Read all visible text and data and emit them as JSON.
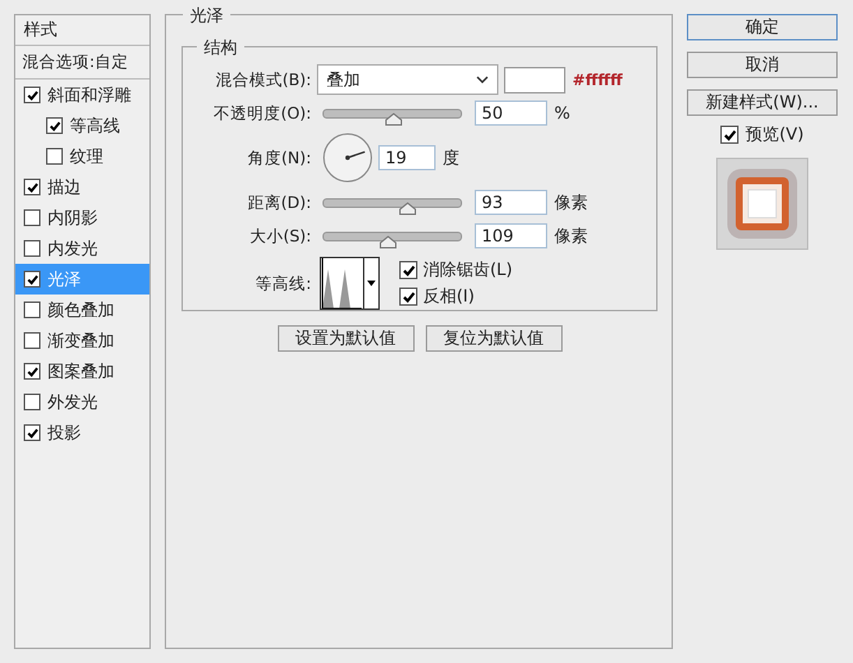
{
  "sidebar": {
    "title": "样式",
    "blend_options": "混合选项:自定",
    "items": [
      {
        "label": "斜面和浮雕",
        "checked": true,
        "selected": false,
        "children": [
          {
            "label": "等高线",
            "checked": true,
            "selected": false
          },
          {
            "label": "纹理",
            "checked": false,
            "selected": false
          }
        ]
      },
      {
        "label": "描边",
        "checked": true,
        "selected": false
      },
      {
        "label": "内阴影",
        "checked": false,
        "selected": false
      },
      {
        "label": "内发光",
        "checked": false,
        "selected": false
      },
      {
        "label": "光泽",
        "checked": true,
        "selected": true
      },
      {
        "label": "颜色叠加",
        "checked": false,
        "selected": false
      },
      {
        "label": "渐变叠加",
        "checked": false,
        "selected": false
      },
      {
        "label": "图案叠加",
        "checked": true,
        "selected": false
      },
      {
        "label": "外发光",
        "checked": false,
        "selected": false
      },
      {
        "label": "投影",
        "checked": true,
        "selected": false
      }
    ]
  },
  "panel": {
    "title": "光泽",
    "group": {
      "title": "结构",
      "blend_mode": {
        "label": "混合模式(B):",
        "value": "叠加",
        "color_hex": "#ffffff"
      },
      "opacity": {
        "label": "不透明度(O):",
        "level": 0.51,
        "value": "50",
        "unit": "%"
      },
      "angle": {
        "label": "角度(N):",
        "value": "19",
        "unit": "度"
      },
      "distance": {
        "label": "距离(D):",
        "level": 0.61,
        "value": "93",
        "unit": "像素"
      },
      "size": {
        "label": "大小(S):",
        "level": 0.47,
        "value": "109",
        "unit": "像素"
      },
      "contour": {
        "label": "等高线:"
      },
      "options": [
        {
          "label": "消除锯齿(L)",
          "checked": true
        },
        {
          "label": "反相(I)",
          "checked": true
        }
      ]
    },
    "buttons": [
      "设置为默认值",
      "复位为默认值"
    ]
  },
  "actions": {
    "buttons": [
      "确定",
      "取消",
      "新建样式(W)..."
    ],
    "preview": {
      "label": "预览(V)",
      "checked": true
    }
  }
}
